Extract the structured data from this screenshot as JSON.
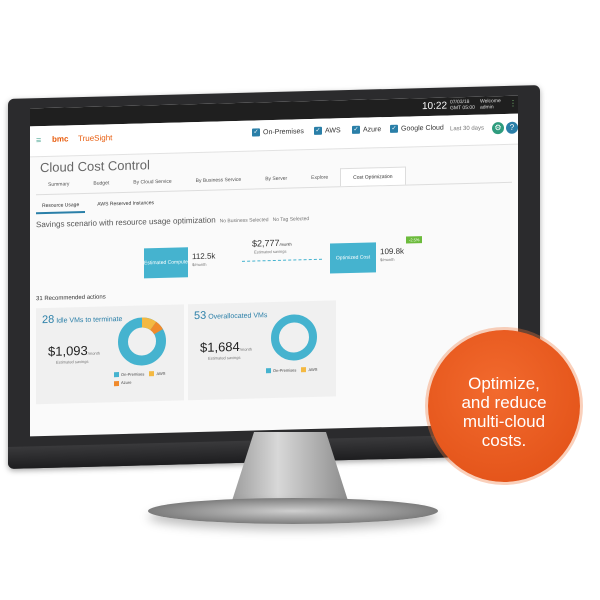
{
  "system": {
    "clock": "10:22",
    "date": "07/03/18",
    "time": "GMT 05:00",
    "welcome": "Welcome",
    "user": "admin"
  },
  "app": {
    "vendor": "bmc",
    "brand": "TrueSight",
    "title": "Cloud Cost Control"
  },
  "filters": [
    {
      "label": "On-Premises",
      "checked": true
    },
    {
      "label": "AWS",
      "checked": true
    },
    {
      "label": "Azure",
      "checked": true
    },
    {
      "label": "Google Cloud",
      "checked": true
    }
  ],
  "range": "Last 30 days",
  "tabs": [
    "Summary",
    "Budget",
    "By Cloud Service",
    "By Business Service",
    "By Server",
    "Explore",
    "Cost Optimization"
  ],
  "subtabs": [
    "Resource Usage",
    "AWS Reserved Instances"
  ],
  "scenario": {
    "title": "Savings scenario with resource usage optimization",
    "business": "No Business Selected",
    "tag": "No Tag Selected"
  },
  "flow": {
    "estimated_label": "Estimated Compute",
    "estimated_value": "112.5k",
    "estimated_unit": "$/month",
    "savings_value": "$2,777",
    "savings_unit": "/month",
    "savings_label": "Estimated savings",
    "optimized_label": "Optimized Cost",
    "optimized_value": "109.8k",
    "optimized_unit": "$/month",
    "pct": "-2.5%"
  },
  "recommended": "31 Recommended actions",
  "cards": [
    {
      "count": "28",
      "title": "Idle VMs to terminate",
      "amount": "$1,093",
      "unit": "/month",
      "label": "Estimated savings",
      "legend": [
        "On-Premises",
        "AWS",
        "Azure"
      ]
    },
    {
      "count": "53",
      "title": "Overallocated VMs",
      "amount": "$1,684",
      "unit": "/month",
      "label": "Estimated savings",
      "legend": [
        "On-Premises",
        "AWS"
      ]
    }
  ],
  "badge": {
    "line1": "Optimize,",
    "line2": "and reduce",
    "line3": "multi-cloud",
    "line4": "costs."
  },
  "colors": {
    "accent": "#45b3cf",
    "orange": "#e85c0d",
    "aws": "#f4b942",
    "azure": "#f08a2c"
  }
}
